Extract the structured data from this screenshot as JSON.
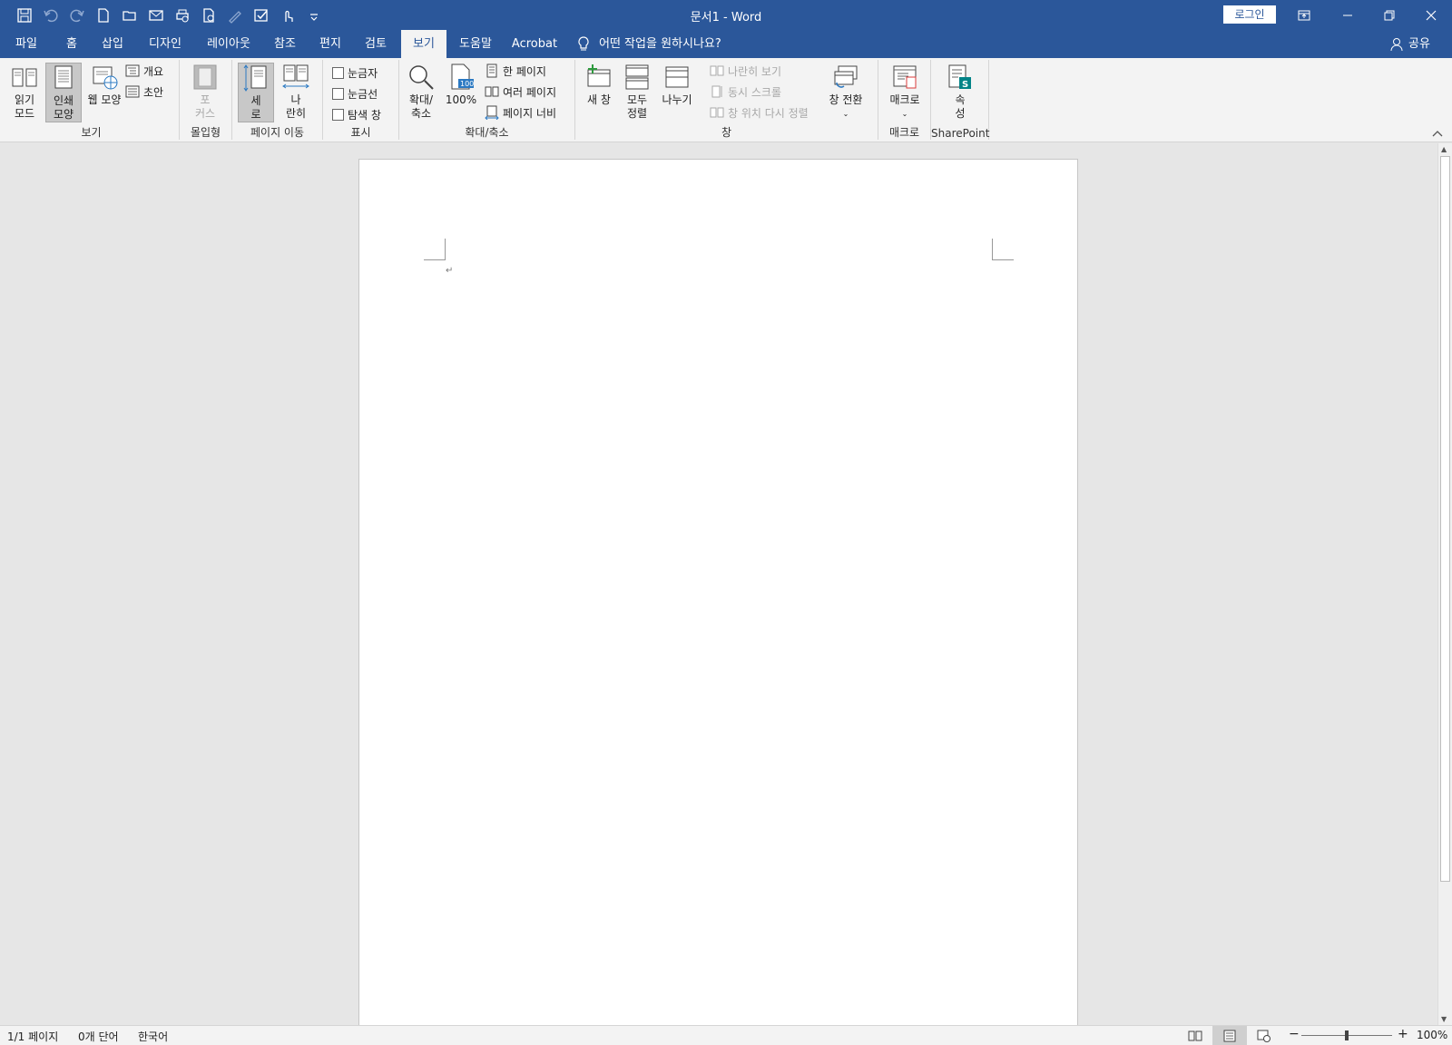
{
  "titlebar": {
    "title": "문서1  -  Word",
    "login": "로그인",
    "qat_icons": [
      "save-icon",
      "undo-icon",
      "redo-icon",
      "new-doc-icon",
      "open-icon",
      "email-icon",
      "print-preview-icon",
      "quick-print-icon",
      "draw-icon",
      "proofing-icon",
      "touch-mode-icon",
      "customize-icon"
    ]
  },
  "tabs": [
    "파일",
    "홈",
    "삽입",
    "디자인",
    "레이아웃",
    "참조",
    "편지",
    "검토",
    "보기",
    "도움말",
    "Acrobat"
  ],
  "active_tab": "보기",
  "tellme": "어떤 작업을 원하시나요?",
  "share": "공유",
  "ribbon": {
    "views": {
      "label": "보기",
      "read_mode_1": "읽기",
      "read_mode_2": "모드",
      "print_layout_1": "인쇄",
      "print_layout_2": "모양",
      "web_layout": "웹 모양",
      "outline": "개요",
      "draft": "초안"
    },
    "immersive": {
      "label": "몰입형",
      "focus_1": "포",
      "focus_2": "커스"
    },
    "page_move": {
      "label": "페이지 이동",
      "vertical_1": "세",
      "vertical_2": "로",
      "side_1": "나",
      "side_2": "란히"
    },
    "show": {
      "label": "표시",
      "ruler": "눈금자",
      "gridlines": "눈금선",
      "nav_pane": "탐색 창"
    },
    "zoom": {
      "label": "확대/축소",
      "zoom_1": "확대/",
      "zoom_2": "축소",
      "hundred": "100%",
      "one_page": "한 페이지",
      "multi_page": "여러 페이지",
      "page_width": "페이지 너비"
    },
    "window": {
      "label": "창",
      "new_window": "새 창",
      "arrange_1": "모두",
      "arrange_2": "정렬",
      "split": "나누기",
      "side_by_side": "나란히 보기",
      "sync_scroll": "동시 스크롤",
      "reset_pos": "창 위치 다시 정렬",
      "switch": "창 전환"
    },
    "macros": {
      "label": "매크로",
      "macros": "매크로"
    },
    "sharepoint": {
      "label": "SharePoint",
      "props_1": "속",
      "props_2": "성"
    }
  },
  "status": {
    "pages": "1/1 페이지",
    "words": "0개 단어",
    "language": "한국어",
    "zoom": "100%"
  }
}
